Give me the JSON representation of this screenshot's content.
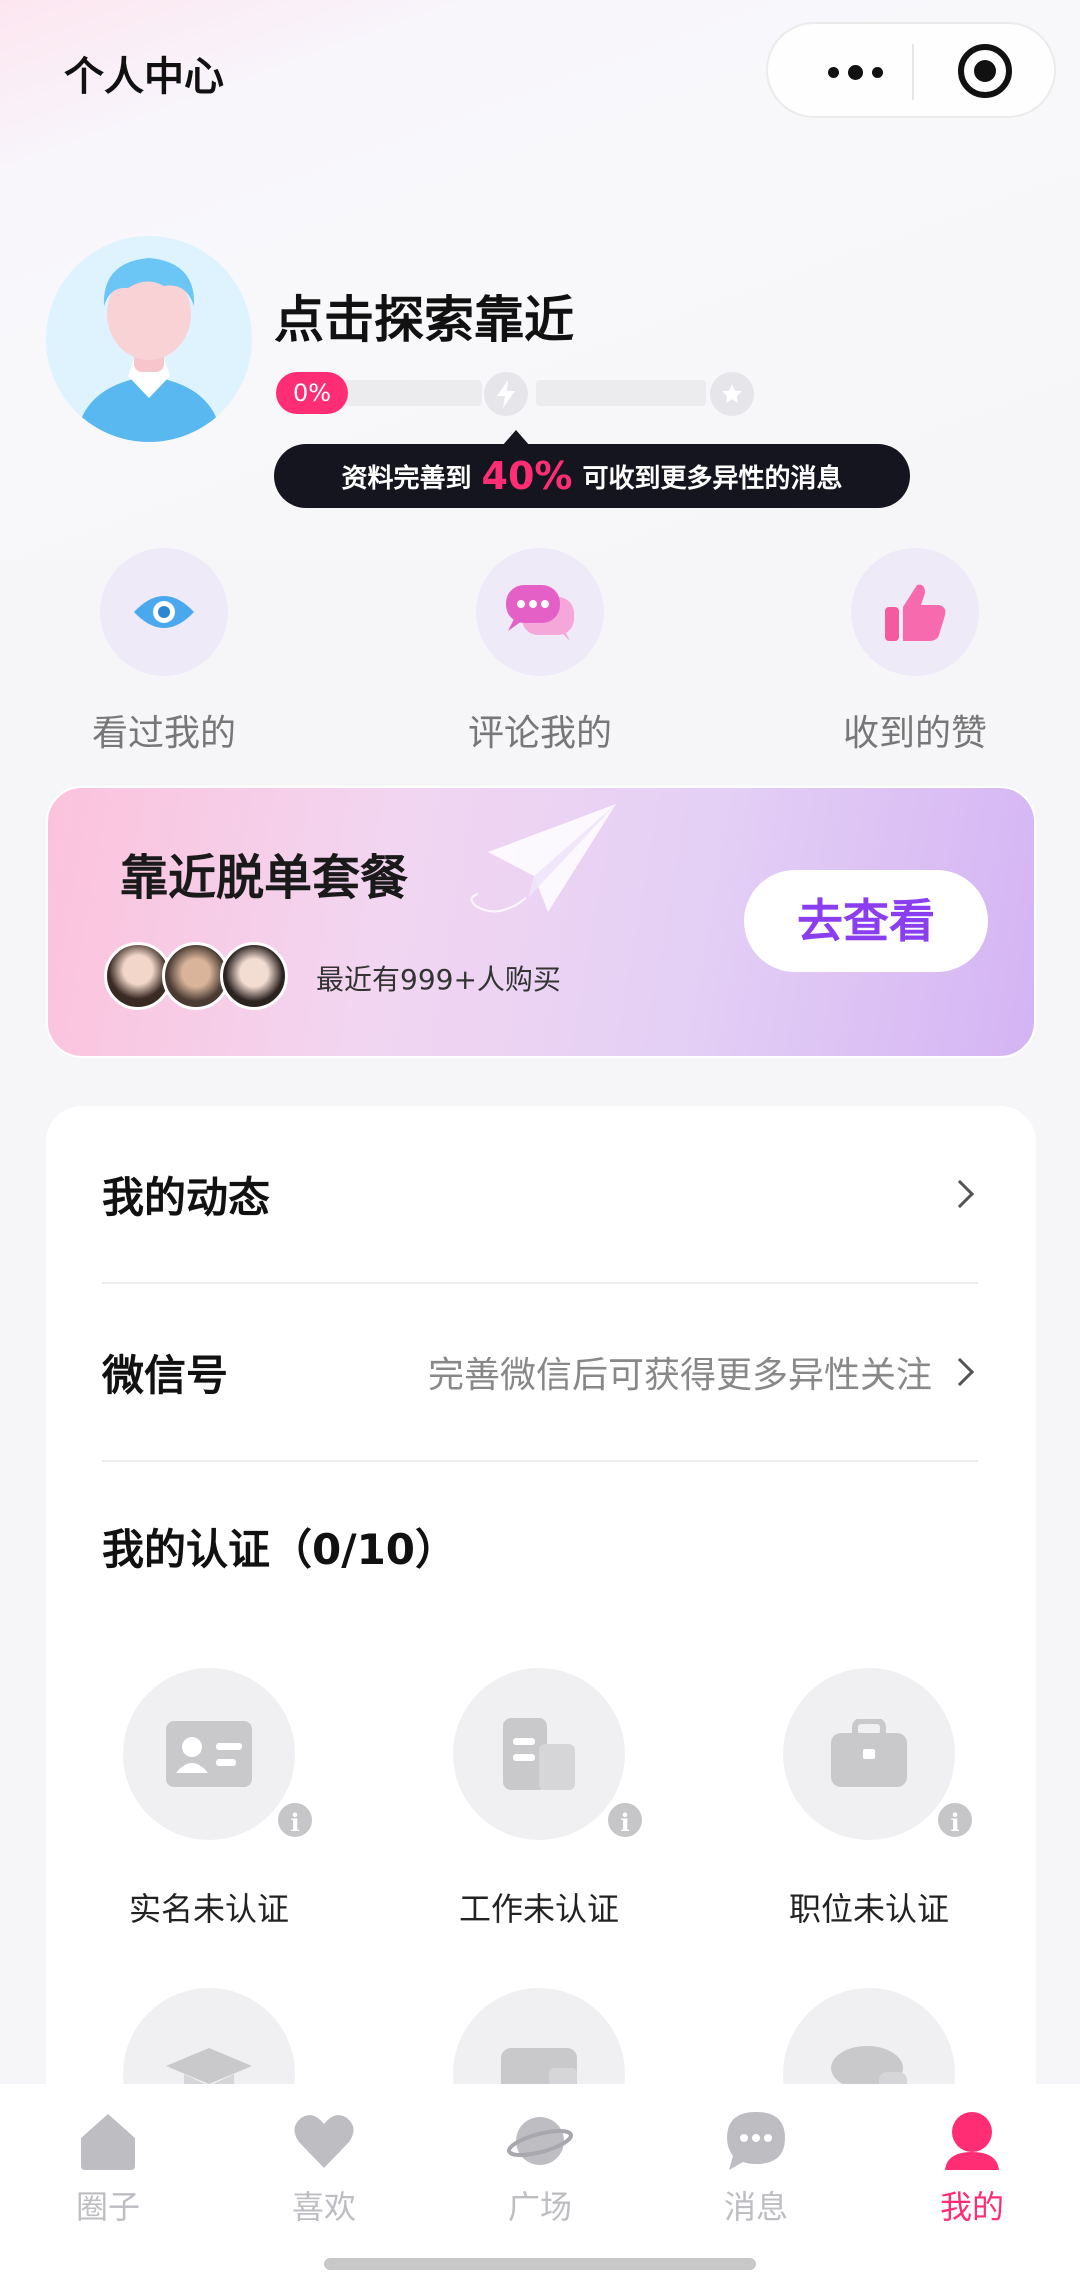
{
  "header": {
    "title": "个人中心"
  },
  "profile": {
    "name": "点击探索靠近",
    "progress": "0%",
    "tip_prefix": "资料完善到",
    "tip_percent": "40%",
    "tip_suffix": "可收到更多异性的消息"
  },
  "quick_actions": [
    {
      "label": "看过我的",
      "icon": "eye-icon"
    },
    {
      "label": "评论我的",
      "icon": "chat-bubbles-icon"
    },
    {
      "label": "收到的赞",
      "icon": "thumbs-up-icon"
    }
  ],
  "promo": {
    "title": "靠近脱单套餐",
    "subtitle": "最近有999+人购买",
    "button": "去查看"
  },
  "menu": {
    "dynamics": {
      "title": "我的动态"
    },
    "wechat": {
      "title": "微信号",
      "hint": "完善微信后可获得更多异性关注"
    }
  },
  "auth": {
    "title": "我的认证（0/10）",
    "items": [
      {
        "label": "实名未认证",
        "icon": "id-card-icon"
      },
      {
        "label": "工作未认证",
        "icon": "work-document-icon"
      },
      {
        "label": "职位未认证",
        "icon": "briefcase-icon"
      },
      {
        "label": "",
        "icon": "graduation-cap-icon"
      },
      {
        "label": "",
        "icon": "wallet-icon"
      },
      {
        "label": "",
        "icon": "car-icon"
      }
    ]
  },
  "tabbar": {
    "items": [
      {
        "label": "圈子",
        "icon": "house-icon"
      },
      {
        "label": "喜欢",
        "icon": "heart-icon"
      },
      {
        "label": "广场",
        "icon": "planet-icon"
      },
      {
        "label": "消息",
        "icon": "message-bubble-icon"
      },
      {
        "label": "我的",
        "icon": "user-icon",
        "active": true
      }
    ]
  },
  "colors": {
    "accent_pink": "#ff2e74",
    "accent_purple": "#8a3ef0",
    "tab_inactive": "#bdbdc2"
  }
}
